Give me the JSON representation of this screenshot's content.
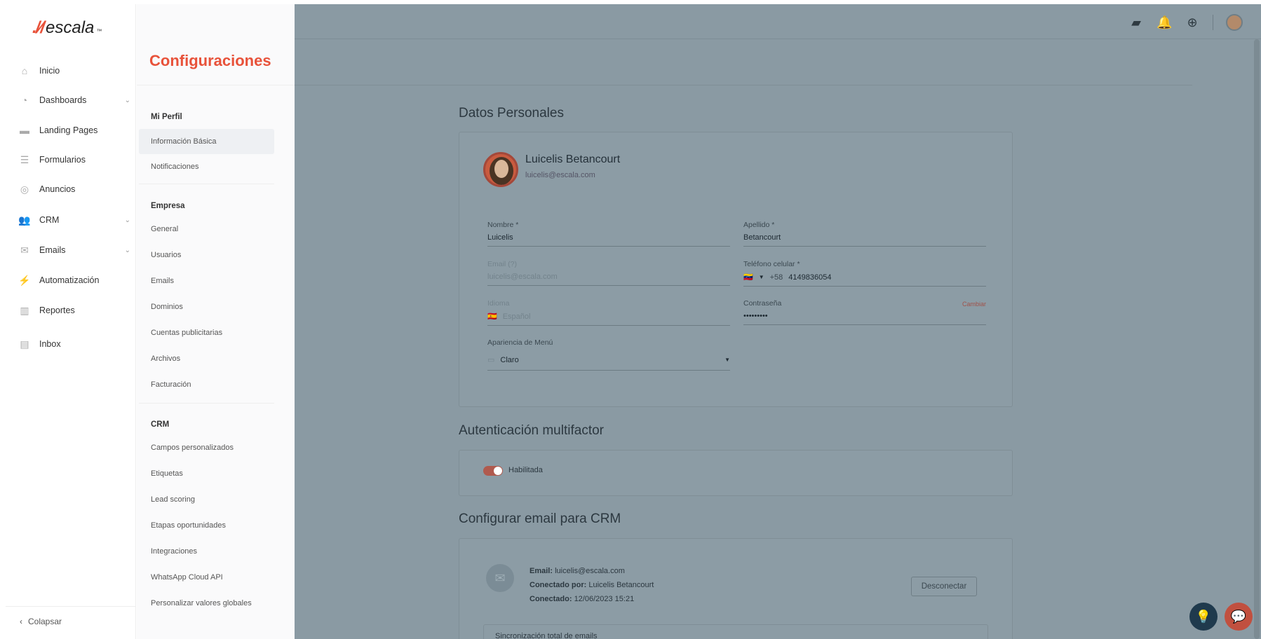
{
  "brand": {
    "mark": "./⁄/",
    "name": "escala",
    "tm": "™"
  },
  "nav": {
    "items": [
      {
        "label": "Inicio",
        "icon": "home-icon",
        "glyph": "⌂"
      },
      {
        "label": "Dashboards",
        "icon": "pie-chart-icon",
        "glyph": "◔"
      },
      {
        "label": "Landing Pages",
        "icon": "folder-icon",
        "glyph": "▬"
      },
      {
        "label": "Formularios",
        "icon": "form-icon",
        "glyph": "☰"
      },
      {
        "label": "Anuncios",
        "icon": "target-icon",
        "glyph": "◎"
      },
      {
        "label": "CRM",
        "icon": "people-icon",
        "glyph": "👥"
      },
      {
        "label": "Emails",
        "icon": "mail-icon",
        "glyph": "✉"
      },
      {
        "label": "Automatización",
        "icon": "lightning-icon",
        "glyph": "⚡"
      },
      {
        "label": "Reportes",
        "icon": "bar-chart-icon",
        "glyph": "▥"
      },
      {
        "label": "Inbox",
        "icon": "chat-icon",
        "glyph": "▤"
      }
    ],
    "chevron": "⌄",
    "collapse_label": "Colapsar",
    "collapse_glyph": "‹"
  },
  "settings": {
    "title": "Configuraciones",
    "sections": {
      "profile": {
        "label": "Mi Perfil",
        "items": [
          "Información Básica",
          "Notificaciones"
        ]
      },
      "company": {
        "label": "Empresa",
        "items": [
          "General",
          "Usuarios",
          "Emails",
          "Dominios",
          "Cuentas publicitarias",
          "Archivos",
          "Facturación"
        ]
      },
      "crm": {
        "label": "CRM",
        "items": [
          "Campos personalizados",
          "Etiquetas",
          "Lead scoring",
          "Etapas oportunidades",
          "Integraciones",
          "WhatsApp Cloud API",
          "Personalizar valores globales"
        ]
      }
    }
  },
  "topbar": {
    "icons": [
      {
        "name": "chat-icon",
        "glyph": "▰"
      },
      {
        "name": "bell-icon",
        "glyph": "🔔"
      },
      {
        "name": "add-circle-icon",
        "glyph": "⊕"
      }
    ]
  },
  "personal": {
    "heading": "Datos Personales",
    "name": "Luicelis Betancourt",
    "email": "luicelis@escala.com",
    "fields": {
      "first_name": {
        "label": "Nombre *",
        "value": "Luicelis"
      },
      "last_name": {
        "label": "Apellido *",
        "value": "Betancourt"
      },
      "email": {
        "label": "Email (?)",
        "value": "luicelis@escala.com"
      },
      "phone": {
        "label": "Teléfono celular *",
        "country_code": "+58",
        "value": "4149836054",
        "flag": "🇻🇪"
      },
      "language": {
        "label": "Idioma",
        "value": "Español",
        "flag": "🇪🇸"
      },
      "password": {
        "label": "Contraseña",
        "value": "•••••••••",
        "action": "Cambiar"
      },
      "menu_appearance": {
        "label": "Apariencia de Menú",
        "value": "Claro"
      }
    }
  },
  "mfa": {
    "heading": "Autenticación multifactor",
    "status": "Habilitada"
  },
  "crm_email": {
    "heading": "Configurar email para CRM",
    "email_label": "Email:",
    "email_value": "luicelis@escala.com",
    "connected_by_label": "Conectado por:",
    "connected_by_value": "Luicelis Betancourt",
    "connected_label": "Conectado:",
    "connected_value": "12/06/2023 15:21",
    "disconnect": "Desconectar",
    "sync_label": "Sincronización total de emails"
  },
  "colors": {
    "brand": "#e8523a",
    "overlay": "#8a9aa3"
  }
}
